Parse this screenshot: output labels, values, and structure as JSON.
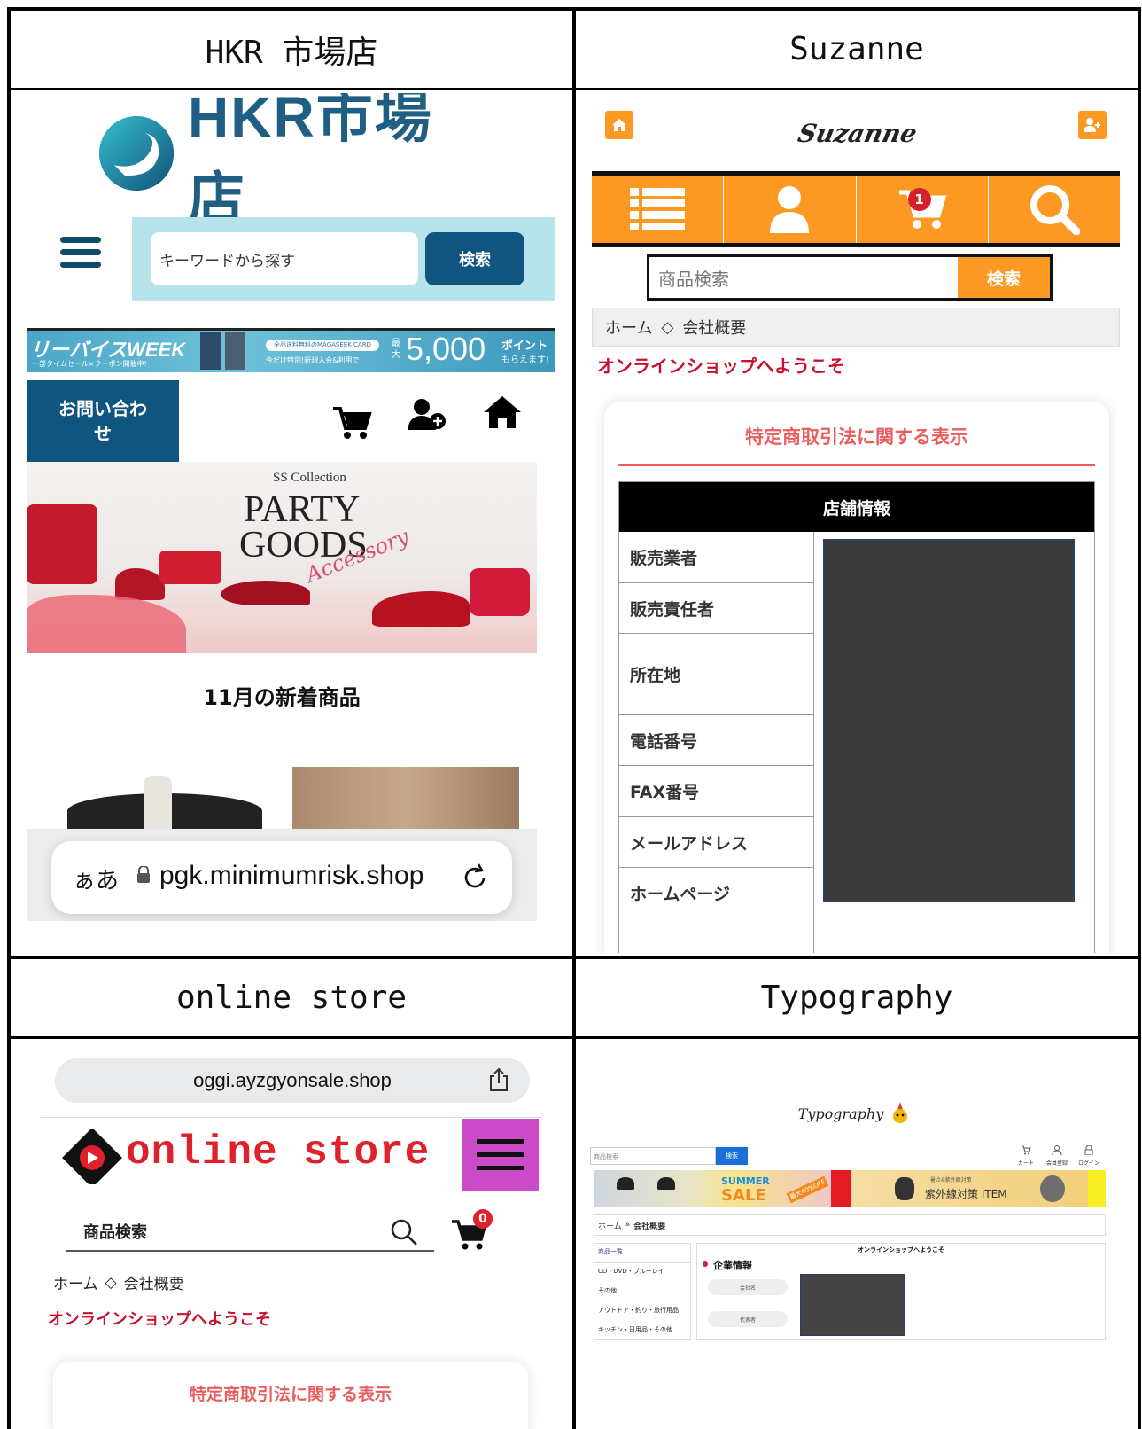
{
  "panels": {
    "hkr": {
      "header": "HKR 市場店",
      "logo_text": "HKR市場店",
      "search_placeholder": "キーワードから探す",
      "search_button": "検索",
      "banner_left": "リーバイスWEEK",
      "banner_left_sub": "一部タイムセール×クーポン開催中!",
      "banner_tag": "全品送料無料のMAGASEEK CARD",
      "banner_mid": "今だけ特別!新規入会&利用で",
      "banner_max": "最大",
      "banner_points": "5,000",
      "banner_points_unit": "ポイント",
      "banner_points_sub": "もらえます!",
      "contact_button": "お問い合わせ",
      "hero_small": "SS Collection",
      "hero_line1": "PARTY",
      "hero_line2": "GOODS",
      "hero_script": "Accessory",
      "section_title": "11月の新着商品",
      "addr_aa": "ぁあ",
      "addr_url": "pgk.minimumrisk.shop"
    },
    "suzanne": {
      "header": "Suzanne",
      "logo_text": "Suzanne",
      "cart_count": "1",
      "search_placeholder": "商品検索",
      "search_button": "検索",
      "breadcrumb_home": "ホーム",
      "breadcrumb_sep": "◇",
      "breadcrumb_current": "会社概要",
      "welcome": "オンラインショップへようこそ",
      "section_title": "特定商取引法に関する表示",
      "table_header": "店舗情報",
      "rows": [
        "販売業者",
        "販売責任者",
        "所在地",
        "電話番号",
        "FAX番号",
        "メールアドレス",
        "ホームページ"
      ]
    },
    "online": {
      "header": "online store",
      "url": "oggi.ayzgyonsale.shop",
      "logo_text": "online store",
      "search_placeholder": "商品検索",
      "cart_count": "0",
      "breadcrumb_home": "ホーム",
      "breadcrumb_sep": "◇",
      "breadcrumb_current": "会社概要",
      "welcome": "オンラインショップへようこそ",
      "section_title": "特定商取引法に関する表示"
    },
    "typography": {
      "header": "Typography",
      "logo_text": "Typography",
      "search_placeholder": "商品検索",
      "search_button": "検索",
      "nav_cart": "カート",
      "nav_register": "会員登録",
      "nav_login": "ログイン",
      "banner_summer": "SUMMER",
      "banner_sale": "SALE",
      "banner_off": "最大40%OFF",
      "banner_uv": "紫外線対策 ITEM",
      "banner_uv_sub": "暑さ&紫外線対策",
      "breadcrumb_home": "ホーム",
      "breadcrumb_sep": "»",
      "breadcrumb_current": "会社概要",
      "welcome": "オンラインショップへようこそ",
      "sidebar_title": "商品一覧",
      "sidebar_items": [
        "CD・DVD・ブルーレイ",
        "その他",
        "アウトドア・釣り・旅行用品",
        "キッチン・日用品・その他"
      ],
      "section_title": "企業情報",
      "field1": "会社名",
      "field2": "代表者"
    }
  },
  "colors": {
    "hkr_blue": "#0f5580",
    "hkr_search_bg": "#b7e4ea",
    "suzanne_orange": "#fb9922",
    "online_magenta": "#cc4bc9",
    "online_red": "#c8102e",
    "typo_blue": "#1a6fd6"
  }
}
